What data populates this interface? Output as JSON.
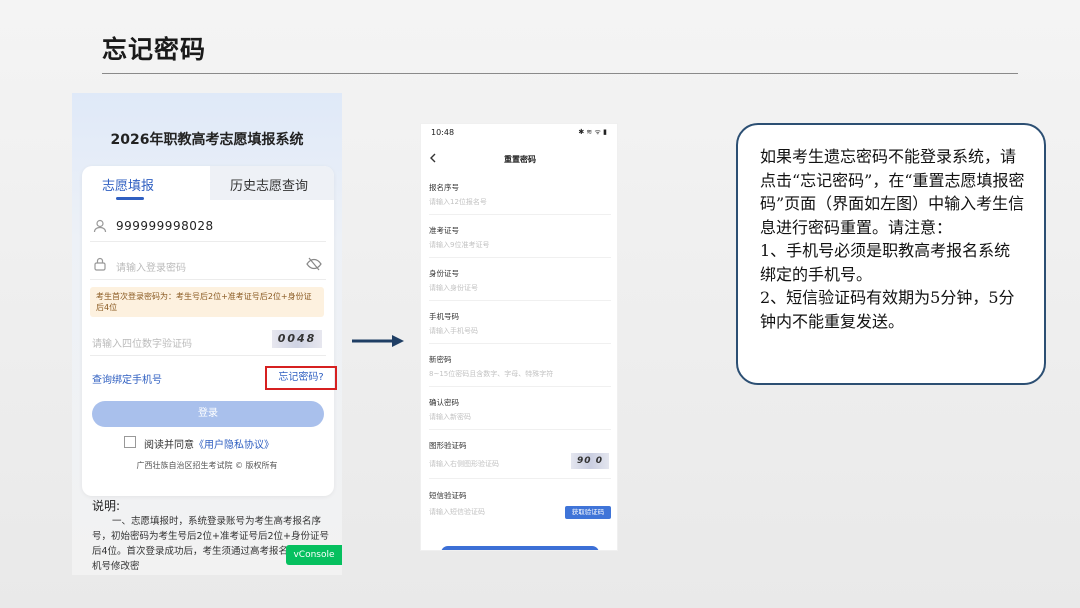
{
  "slide": {
    "title": "忘记密码"
  },
  "left_phone": {
    "system_title": "2026年职教高考志愿填报系统",
    "tabs": [
      {
        "label": "志愿填报",
        "active": true
      },
      {
        "label": "历史志愿查询",
        "active": false
      }
    ],
    "account": {
      "icon": "user-icon",
      "value": "999999998028"
    },
    "password": {
      "icon": "lock-icon",
      "placeholder": "请输入登录密码",
      "toggle_icon": "eye-off-icon"
    },
    "notice": "考生首次登录密码为：考生号后2位+准考证号后2位+身份证后4位",
    "captcha": {
      "placeholder": "请输入四位数字验证码",
      "image_text": "0048"
    },
    "bind_phone_link": "查询绑定手机号",
    "forgot_link": "忘记密码?",
    "login_button": "登录",
    "agree": {
      "prefix": "阅读并同意",
      "link": "《用户隐私协议》"
    },
    "copyright": "广西壮族自治区招生考试院 © 版权所有",
    "explain_title": "说明:",
    "explain_body": "一、志愿填报时，系统登录账号为考生高考报名序号，初始密码为考生号后2位+准考证号后2位+身份证号后4位。首次登录成功后，考生须通过高考报名时绑定的手机号修改密",
    "vconsole": "vConsole"
  },
  "right_phone": {
    "status_time": "10:48",
    "status_right": "✱ ≋ ᯤ ▮",
    "title": "重置密码",
    "back_icon": "chevron-left-icon",
    "fields": [
      {
        "label": "报名序号",
        "placeholder": "请输入12位报名号"
      },
      {
        "label": "准考证号",
        "placeholder": "请输入9位准考证号"
      },
      {
        "label": "身份证号",
        "placeholder": "请输入身份证号"
      },
      {
        "label": "手机号码",
        "placeholder": "请输入手机号码"
      },
      {
        "label": "新密码",
        "placeholder": "8~15位密码且含数字、字母、特殊字符"
      },
      {
        "label": "确认密码",
        "placeholder": "请输入新密码"
      },
      {
        "label": "图形验证码",
        "placeholder": "请输入右侧图形验证码"
      },
      {
        "label": "短信验证码",
        "placeholder": "请输入短信验证码"
      }
    ],
    "captcha_image_text": "90 0",
    "sms_button": "获取验证码"
  },
  "info_box": {
    "text": "如果考生遗忘密码不能登录系统，请点击“忘记密码”，在“重置志愿填报密码”页面（界面如左图）中输入考生信息进行密码重置。请注意：\n1、手机号必须是职教高考报名系统绑定的手机号。\n2、短信验证码有效期为5分钟，5分钟内不能重复发送。"
  },
  "colors": {
    "accent": "#2f5fc1",
    "highlight_border": "#d62020",
    "box_border": "#2c4f73"
  }
}
